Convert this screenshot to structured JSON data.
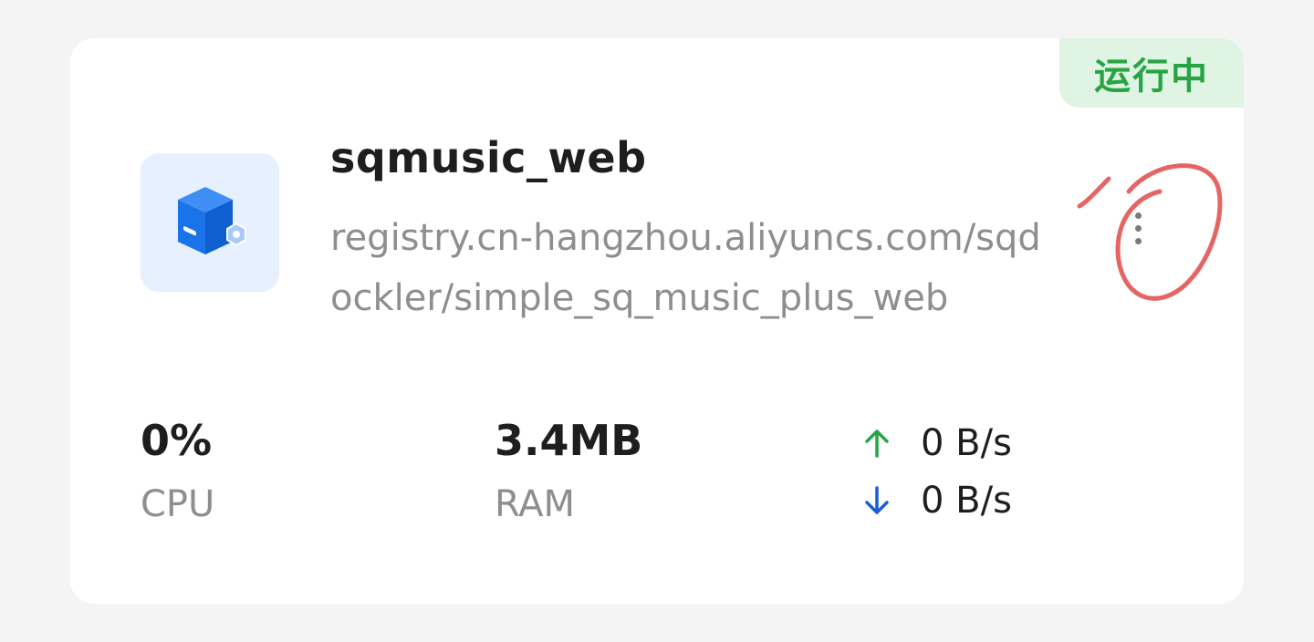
{
  "container": {
    "status": "运行中",
    "name": "sqmusic_web",
    "image": "registry.cn-hangzhou.aliyuncs.com/sqdockler/simple_sq_music_plus_web",
    "icon": "docker-container-icon",
    "more_icon": "more-vertical-icon"
  },
  "stats": {
    "cpu_value": "0%",
    "cpu_label": "CPU",
    "ram_value": "3.4MB",
    "ram_label": "RAM",
    "upload_speed": "0 B/s",
    "download_speed": "0 B/s"
  },
  "annotation": {
    "text": "1"
  },
  "colors": {
    "status_bg": "#dff4e3",
    "status_text": "#27a545",
    "icon_bg": "#e6f0fe",
    "icon_blue": "#1a73e8",
    "upload_arrow": "#27a545",
    "download_arrow": "#1a5fd0",
    "annotation_red": "#e04a4a"
  }
}
